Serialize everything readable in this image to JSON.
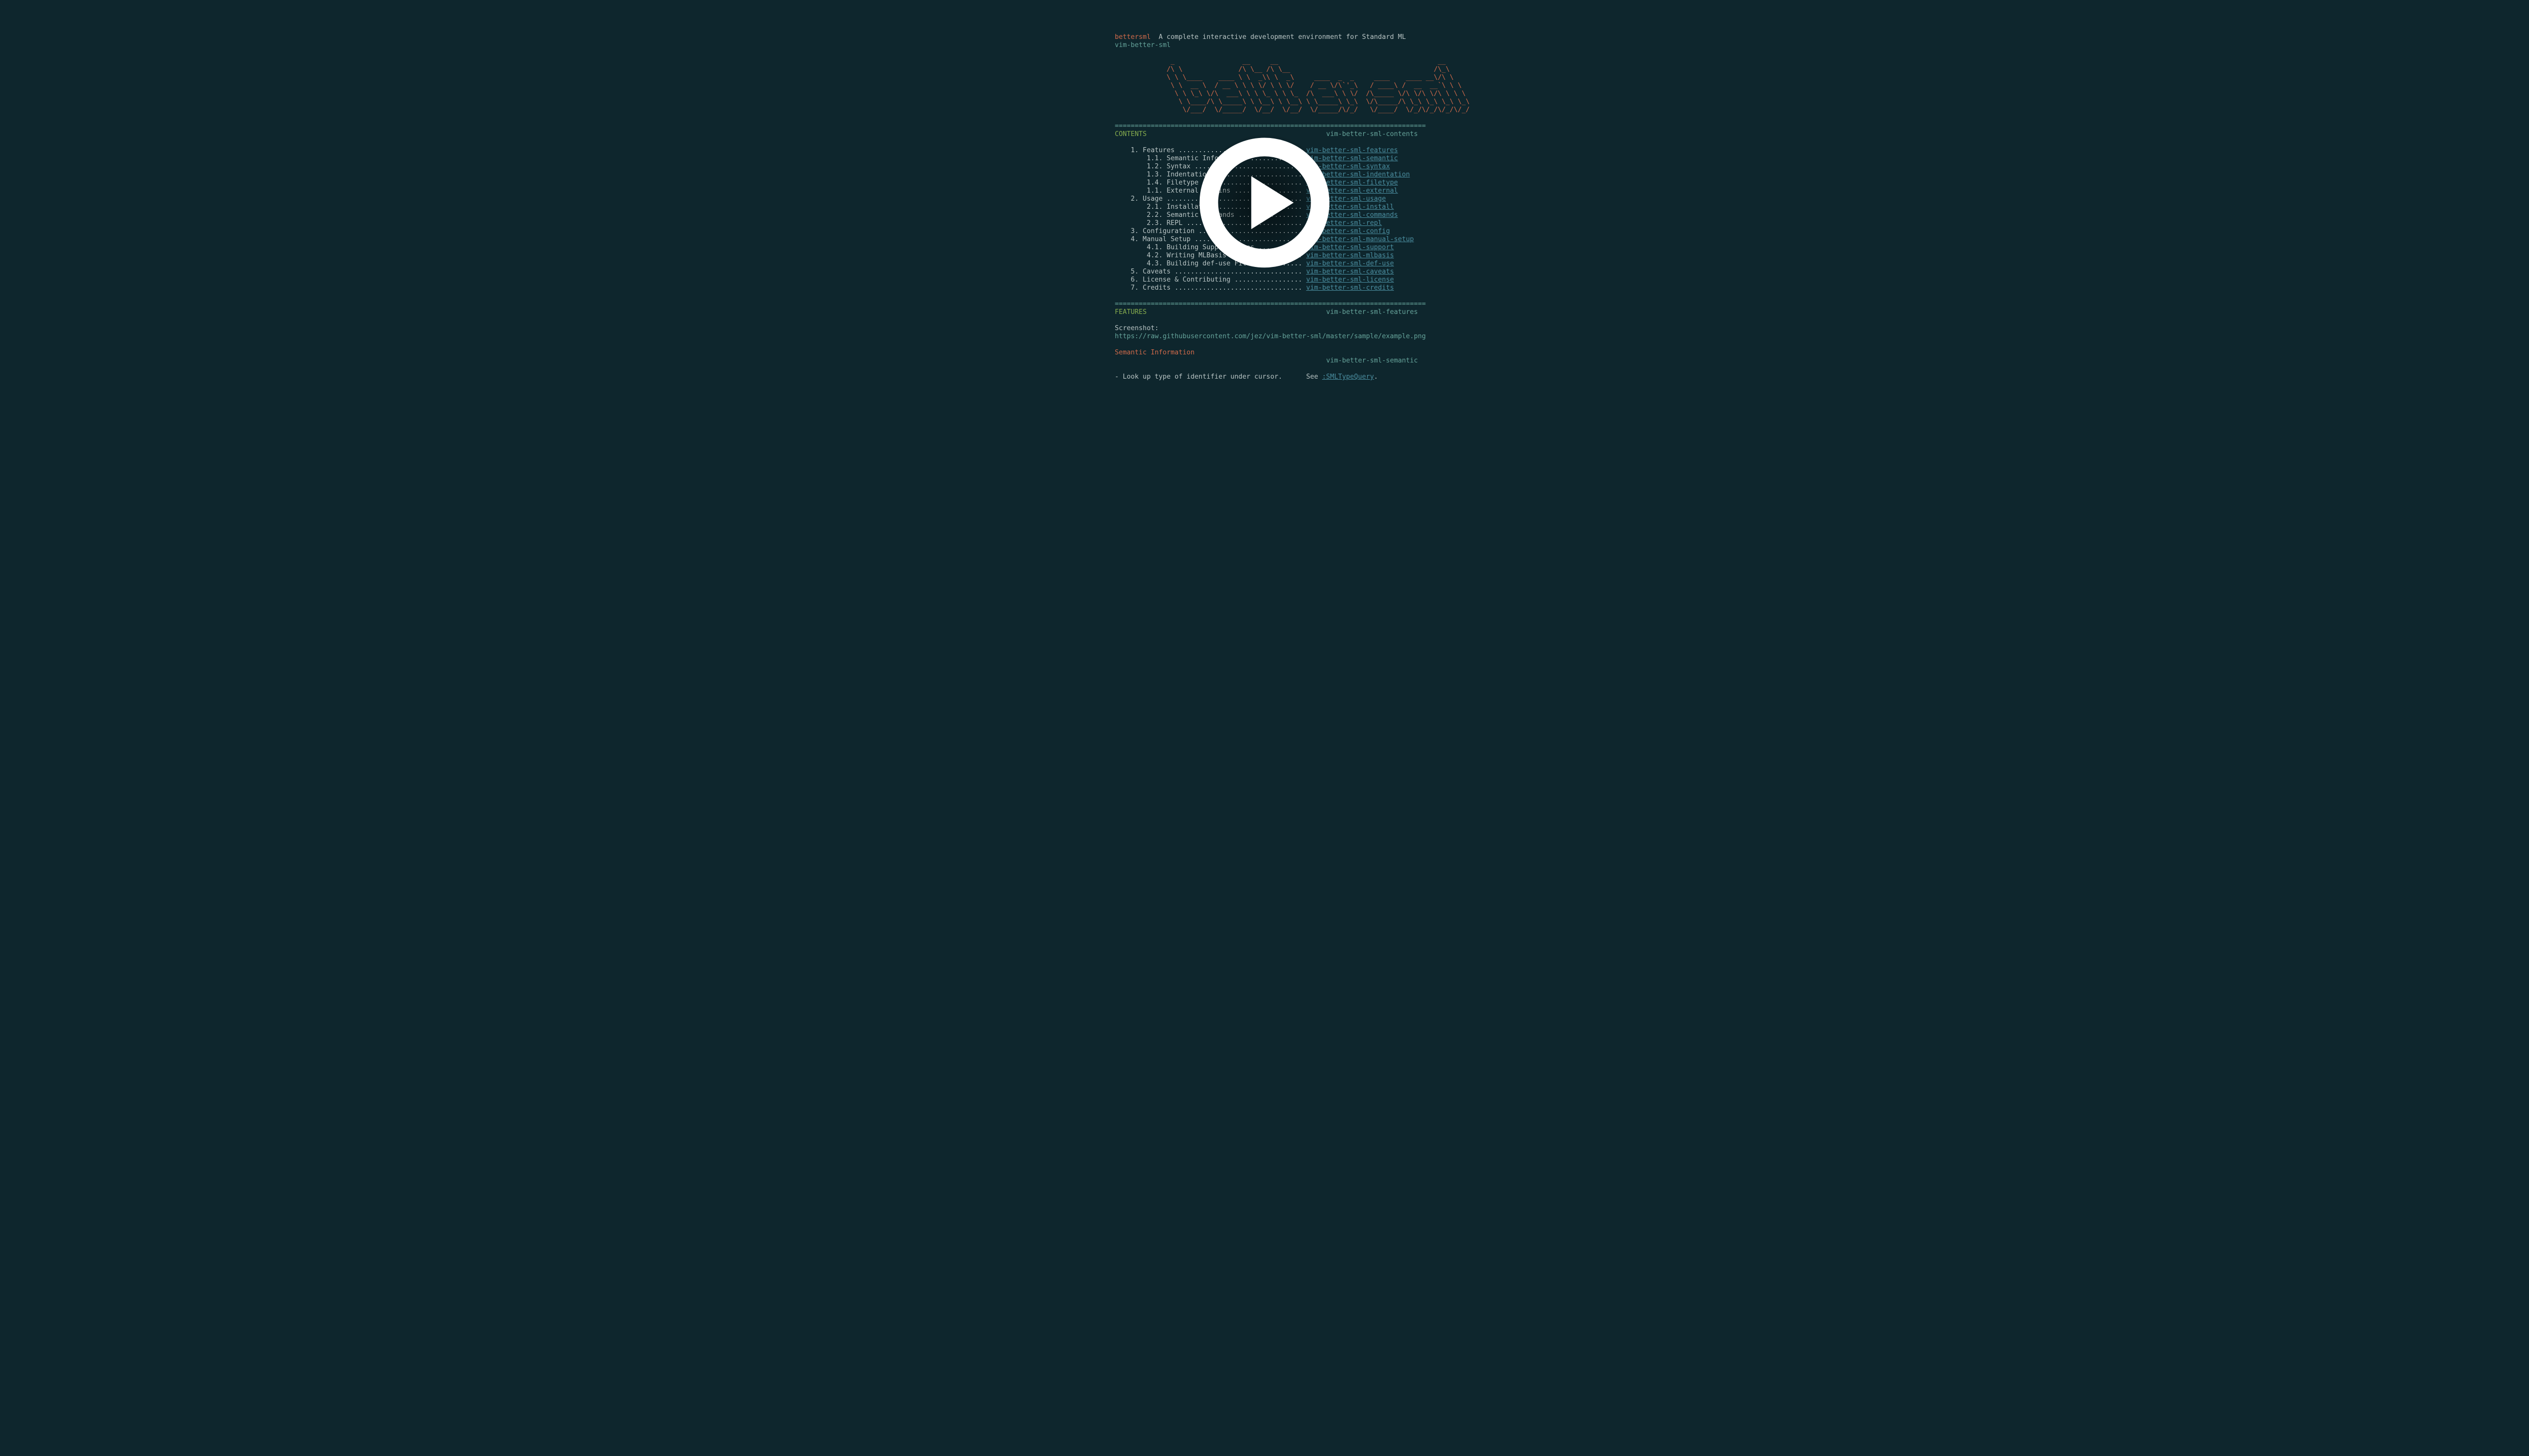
{
  "header": {
    "title": "bettersml",
    "tagline": "  A complete interactive development environment for Standard ML",
    "plugin_tag": "vim-better-sml"
  },
  "ascii_lines": [
    "              _                 __     __                                        __",
    "             /\\ \\              /\\ \\__ /\\ \\__                                    /\\_\\",
    "             \\ \\ \\____    ____ \\ \\  _\\\\ \\  _\\     ____  _  _     ____    ____ __\\/\\ \\",
    "              \\ \\  __ \\  / __ \\ \\ \\ \\/ \\ \\ \\/    / __ \\/\\`'_\\   / ____\\ /  __  __`\\ \\ \\",
    "               \\ \\ \\_\\ \\/\\  ___\\ \\ \\ \\_ \\ \\ \\_  /\\  ___\\ \\ \\/  /\\_____ \\/\\ \\/\\ \\/\\ \\ \\ \\",
    "                \\ \\____/\\ \\_____\\ \\ \\__\\ \\ \\__\\ \\ \\_____\\ \\_\\  \\/\\_____/\\ \\_\\ \\_\\ \\_\\ \\_\\",
    "                 \\/___/  \\/_____/  \\/__/  \\/__/  \\/_____/\\/_/   \\/____/  \\/_/\\/_/\\/_/\\/_/"
  ],
  "rule": "==============================================================================",
  "contents": {
    "heading": "CONTENTS",
    "tag": "vim-better-sml-contents",
    "items": [
      {
        "text": "    1. Features ...............................",
        "link": "vim-better-sml-features"
      },
      {
        "text": "        1.1. Semantic Information .............",
        "link": "vim-better-sml-semantic"
      },
      {
        "text": "        1.2. Syntax ...........................",
        "link": "vim-better-sml-syntax"
      },
      {
        "text": "        1.3. Indentation ......................",
        "link": "vim-better-sml-indentation"
      },
      {
        "text": "        1.4. Filetype .........................",
        "link": "vim-better-sml-filetype"
      },
      {
        "text": "        1.1. External Plugins .................",
        "link": "vim-better-sml-external"
      },
      {
        "text": "    2. Usage ..................................",
        "link": "vim-better-sml-usage"
      },
      {
        "text": "        2.1. Installation .....................",
        "link": "vim-better-sml-install"
      },
      {
        "text": "        2.2. Semantic Commands ................",
        "link": "vim-better-sml-commands"
      },
      {
        "text": "        2.3. REPL .............................",
        "link": "vim-better-sml-repl"
      },
      {
        "text": "    3. Configuration ..........................",
        "link": "vim-better-sml-config"
      },
      {
        "text": "    4. Manual Setup ...........................",
        "link": "vim-better-sml-manual-setup"
      },
      {
        "text": "        4.1. Building Support Files ...........",
        "link": "vim-better-sml-support"
      },
      {
        "text": "        4.2. Writing MLBasis Files ............",
        "link": "vim-better-sml-mlbasis"
      },
      {
        "text": "        4.3. Building def-use Files ...........",
        "link": "vim-better-sml-def-use"
      },
      {
        "text": "    5. Caveats ................................",
        "link": "vim-better-sml-caveats"
      },
      {
        "text": "    6. License & Contributing .................",
        "link": "vim-better-sml-license"
      },
      {
        "text": "    7. Credits ................................",
        "link": "vim-better-sml-credits"
      }
    ]
  },
  "features": {
    "heading": "FEATURES",
    "tag": "vim-better-sml-features",
    "screenshot_label": "Screenshot:",
    "screenshot_url": "https://raw.githubusercontent.com/jez/vim-better-sml/master/sample/example.png",
    "semantic_heading": "Semantic Information",
    "semantic_tag": "vim-better-sml-semantic",
    "bullet_prefix": "- Look up type of identifier under cursor.      See ",
    "bullet_link": ":SMLTypeQuery",
    "bullet_suffix": "."
  }
}
